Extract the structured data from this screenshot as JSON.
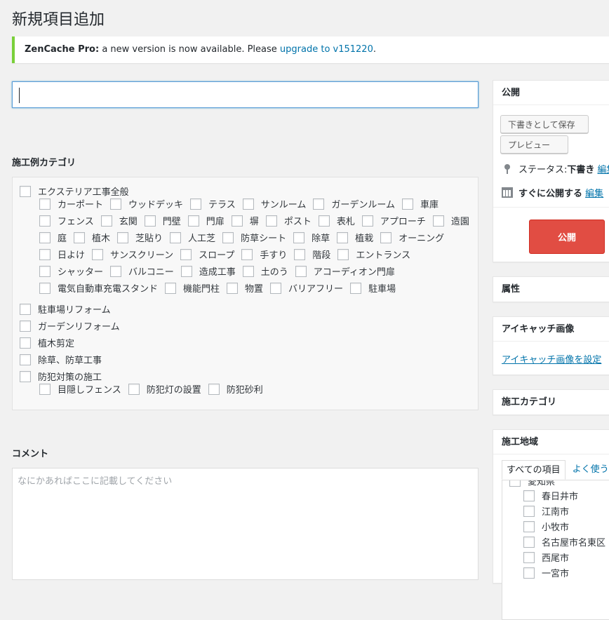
{
  "page": {
    "title": "新規項目追加"
  },
  "notice": {
    "product": "ZenCache Pro:",
    "message": " a new version is now available. Please ",
    "link": "upgrade to v151220",
    "end": "."
  },
  "categories": {
    "label": "施工例カテゴリ",
    "rows": [
      {
        "indent": false,
        "items": [
          "エクステリア工事全般"
        ]
      },
      {
        "indent": true,
        "items": [
          "カーポート",
          "ウッドデッキ",
          "テラス",
          "サンルーム",
          "ガーデンルーム",
          "車庫"
        ]
      },
      {
        "indent": true,
        "items": [
          "フェンス",
          "玄関",
          "門壁",
          "門扉",
          "塀",
          "ポスト",
          "表札",
          "アプローチ",
          "造園"
        ]
      },
      {
        "indent": true,
        "items": [
          "庭",
          "植木",
          "芝貼り",
          "人工芝",
          "防草シート",
          "除草",
          "植栽",
          "オーニング"
        ]
      },
      {
        "indent": true,
        "items": [
          "日よけ",
          "サンスクリーン",
          "スロープ",
          "手すり",
          "階段",
          "エントランス"
        ]
      },
      {
        "indent": true,
        "items": [
          "シャッター",
          "バルコニー",
          "造成工事",
          "土のう",
          "アコーディオン門扉"
        ]
      },
      {
        "indent": true,
        "items": [
          "電気自動車充電スタンド",
          "機能門柱",
          "物置",
          "バリアフリー",
          "駐車場"
        ]
      },
      {
        "indent": false,
        "items": [
          "駐車場リフォーム"
        ]
      },
      {
        "indent": false,
        "items": [
          "ガーデンリフォーム"
        ]
      },
      {
        "indent": false,
        "items": [
          "植木剪定"
        ]
      },
      {
        "indent": false,
        "items": [
          "除草、防草工事"
        ]
      },
      {
        "indent": false,
        "items": [
          "防犯対策の施工"
        ]
      },
      {
        "indent": true,
        "items": [
          "目隠しフェンス",
          "防犯灯の設置",
          "防犯砂利"
        ]
      }
    ]
  },
  "comment": {
    "label": "コメント",
    "placeholder": "なにかあればここに記載してください"
  },
  "publish": {
    "title": "公開",
    "save_draft": "下書きとして保存",
    "preview": "プレビュー",
    "status_label": "ステータス: ",
    "status_value": "下書き",
    "status_edit": "編集",
    "schedule_label": "すぐに公開する",
    "schedule_edit": "編集",
    "publish_button": "公開"
  },
  "attributes": {
    "title": "属性"
  },
  "featured": {
    "title": "アイキャッチ画像",
    "link": "アイキャッチ画像を設定"
  },
  "construction_category": {
    "title": "施工カテゴリ"
  },
  "region": {
    "title": "施工地域",
    "tab_all": "すべての項目",
    "tab_popular": "よく使う",
    "partial_top": "愛知県",
    "items": [
      "春日井市",
      "江南市",
      "小牧市",
      "名古屋市名東区",
      "西尾市",
      "一宮市"
    ]
  }
}
